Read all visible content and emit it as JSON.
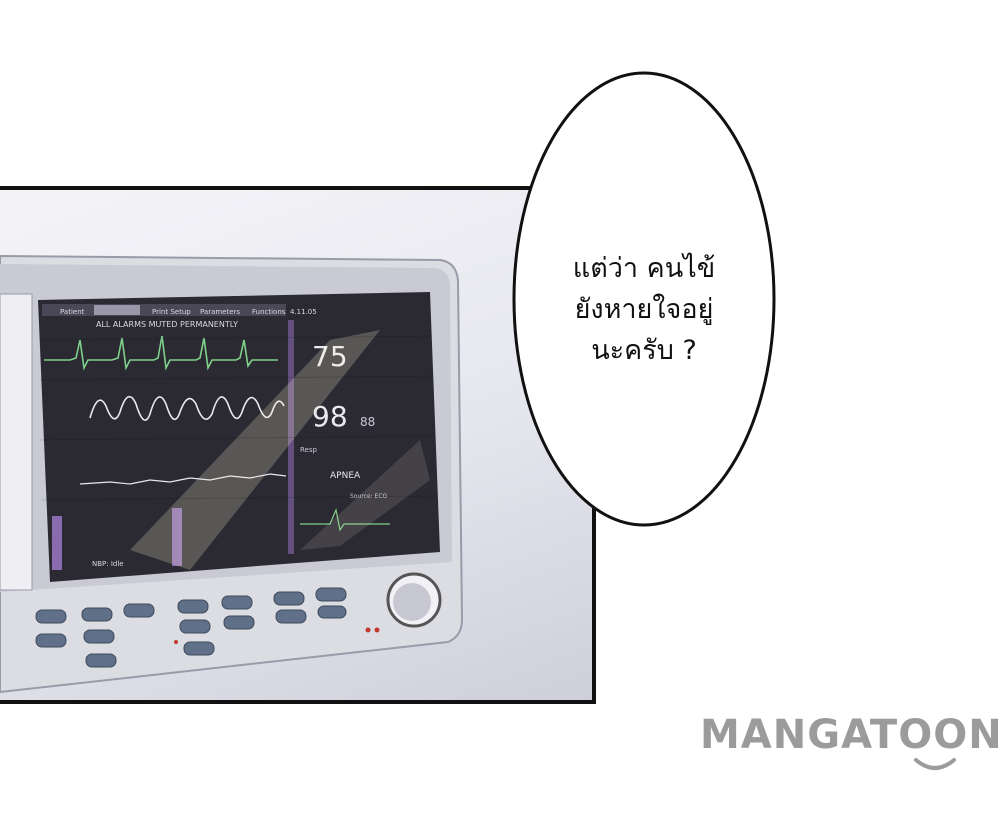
{
  "speech_bubble": {
    "lines": [
      "แต่ว่า คนไข้",
      "ยังหายใจอยู่",
      "นะครับ ?"
    ]
  },
  "monitor": {
    "menu": [
      "Patient",
      "",
      "Print Setup",
      "Parameters",
      "Functions",
      "4.11.05"
    ],
    "alarm_banner": "ALL ALARMS MUTED PERMANENTLY",
    "heart_rate": "75",
    "spo2": "98",
    "secondary_value": "88",
    "apnea_label": "APNEA",
    "nbp_label": "NBP: Idle",
    "resp_label": "Resp",
    "source_label": "Source: ECG"
  },
  "watermark": {
    "text": "MANGATOON"
  },
  "colors": {
    "ecg_green": "#7fd08a",
    "wave_white": "#e8e8f0",
    "screen_bg": "#2b2a33",
    "purple_accent": "#8a6bb0",
    "watermark_gray": "#9b9b9b"
  }
}
